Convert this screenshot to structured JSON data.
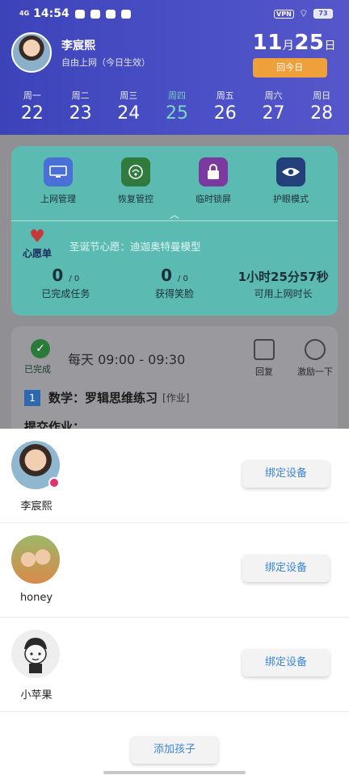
{
  "status_bar": {
    "network": "4G",
    "time": "14:54",
    "vpn": "VPN",
    "battery": "73"
  },
  "profile": {
    "name": "李宸熙",
    "subtitle": "自由上网（今日生效）"
  },
  "date": {
    "month": "11",
    "month_unit": "月",
    "day": "25",
    "day_unit": "日",
    "today_button": "回今日"
  },
  "week": [
    {
      "weekday": "周一",
      "date": "22"
    },
    {
      "weekday": "周二",
      "date": "23"
    },
    {
      "weekday": "周三",
      "date": "24"
    },
    {
      "weekday": "周四",
      "date": "25"
    },
    {
      "weekday": "周五",
      "date": "26"
    },
    {
      "weekday": "周六",
      "date": "27"
    },
    {
      "weekday": "周日",
      "date": "28"
    }
  ],
  "tools": [
    {
      "label": "上网管理",
      "icon": "monitor-icon",
      "color": "#4a6fd6"
    },
    {
      "label": "恢复管控",
      "icon": "restore-control-icon",
      "color": "#2f7a3c"
    },
    {
      "label": "临时锁屏",
      "icon": "lock-icon",
      "color": "#7a3aa0"
    },
    {
      "label": "护眼模式",
      "icon": "eye-icon",
      "color": "#23407a"
    }
  ],
  "wish": {
    "label": "心愿单",
    "text": "圣诞节心愿：迪迦奥特曼模型"
  },
  "stats": [
    {
      "value": "0",
      "suffix": "/ 0",
      "label": "已完成任务"
    },
    {
      "value": "0",
      "suffix": "/ 0",
      "label": "获得笑脸"
    },
    {
      "value": "1小时25分57秒",
      "suffix": "",
      "label": "可用上网时长"
    }
  ],
  "task": {
    "status": "已完成",
    "time": "每天 09:00 - 09:30",
    "reply": "回复",
    "encourage": "激励一下",
    "number": "1",
    "name": "数学：罗辑思维练习",
    "tag": "[作业]",
    "submit": "提交作业："
  },
  "children": [
    {
      "name": "李宸熙",
      "button": "绑定设备",
      "selected": true
    },
    {
      "name": "honey",
      "button": "绑定设备",
      "selected": false
    },
    {
      "name": "小苹果",
      "button": "绑定设备",
      "selected": false
    }
  ],
  "add_child": "添加孩子"
}
